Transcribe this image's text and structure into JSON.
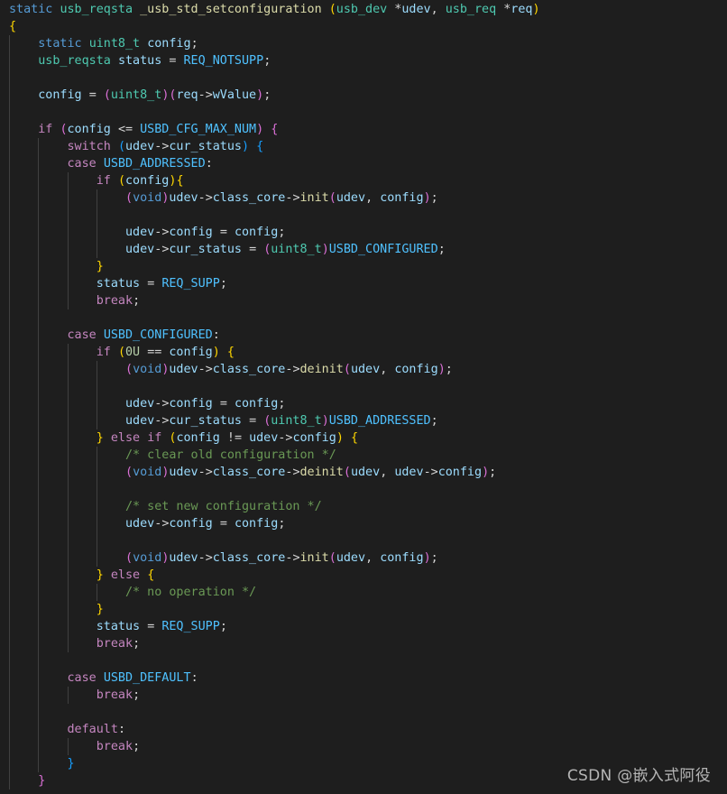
{
  "editor": {
    "language": "c",
    "theme": "dark",
    "background": "#1e1e1e",
    "colors": {
      "keyword": "#569cd6",
      "control": "#c586c0",
      "type": "#4ec9b0",
      "function": "#dcdcaa",
      "variable": "#9cdcfe",
      "macro": "#4fc1ff",
      "number": "#b5cea8",
      "comment": "#6a9955",
      "bracket_level_1": "#ffd700",
      "bracket_level_2": "#da70d6",
      "bracket_level_3": "#179fff"
    },
    "lines": [
      "static usb_reqsta _usb_std_setconfiguration (usb_dev *udev, usb_req *req)",
      "{",
      "    static uint8_t config;",
      "    usb_reqsta status = REQ_NOTSUPP;",
      "",
      "    config = (uint8_t)(req->wValue);",
      "",
      "    if (config <= USBD_CFG_MAX_NUM) {",
      "        switch (udev->cur_status) {",
      "        case USBD_ADDRESSED:",
      "            if (config){",
      "                (void)udev->class_core->init(udev, config);",
      "",
      "                udev->config = config;",
      "                udev->cur_status = (uint8_t)USBD_CONFIGURED;",
      "            }",
      "            status = REQ_SUPP;",
      "            break;",
      "",
      "        case USBD_CONFIGURED:",
      "            if (0U == config) {",
      "                (void)udev->class_core->deinit(udev, config);",
      "",
      "                udev->config = config;",
      "                udev->cur_status = (uint8_t)USBD_ADDRESSED;",
      "            } else if (config != udev->config) {",
      "                /* clear old configuration */",
      "                (void)udev->class_core->deinit(udev, udev->config);",
      "",
      "                /* set new configuration */",
      "                udev->config = config;",
      "",
      "                (void)udev->class_core->init(udev, config);",
      "            } else {",
      "                /* no operation */",
      "            }",
      "            status = REQ_SUPP;",
      "            break;",
      "",
      "        case USBD_DEFAULT:",
      "            break;",
      "",
      "        default:",
      "            break;",
      "        }",
      "    }"
    ]
  },
  "watermark": "CSDN @嵌入式阿役"
}
